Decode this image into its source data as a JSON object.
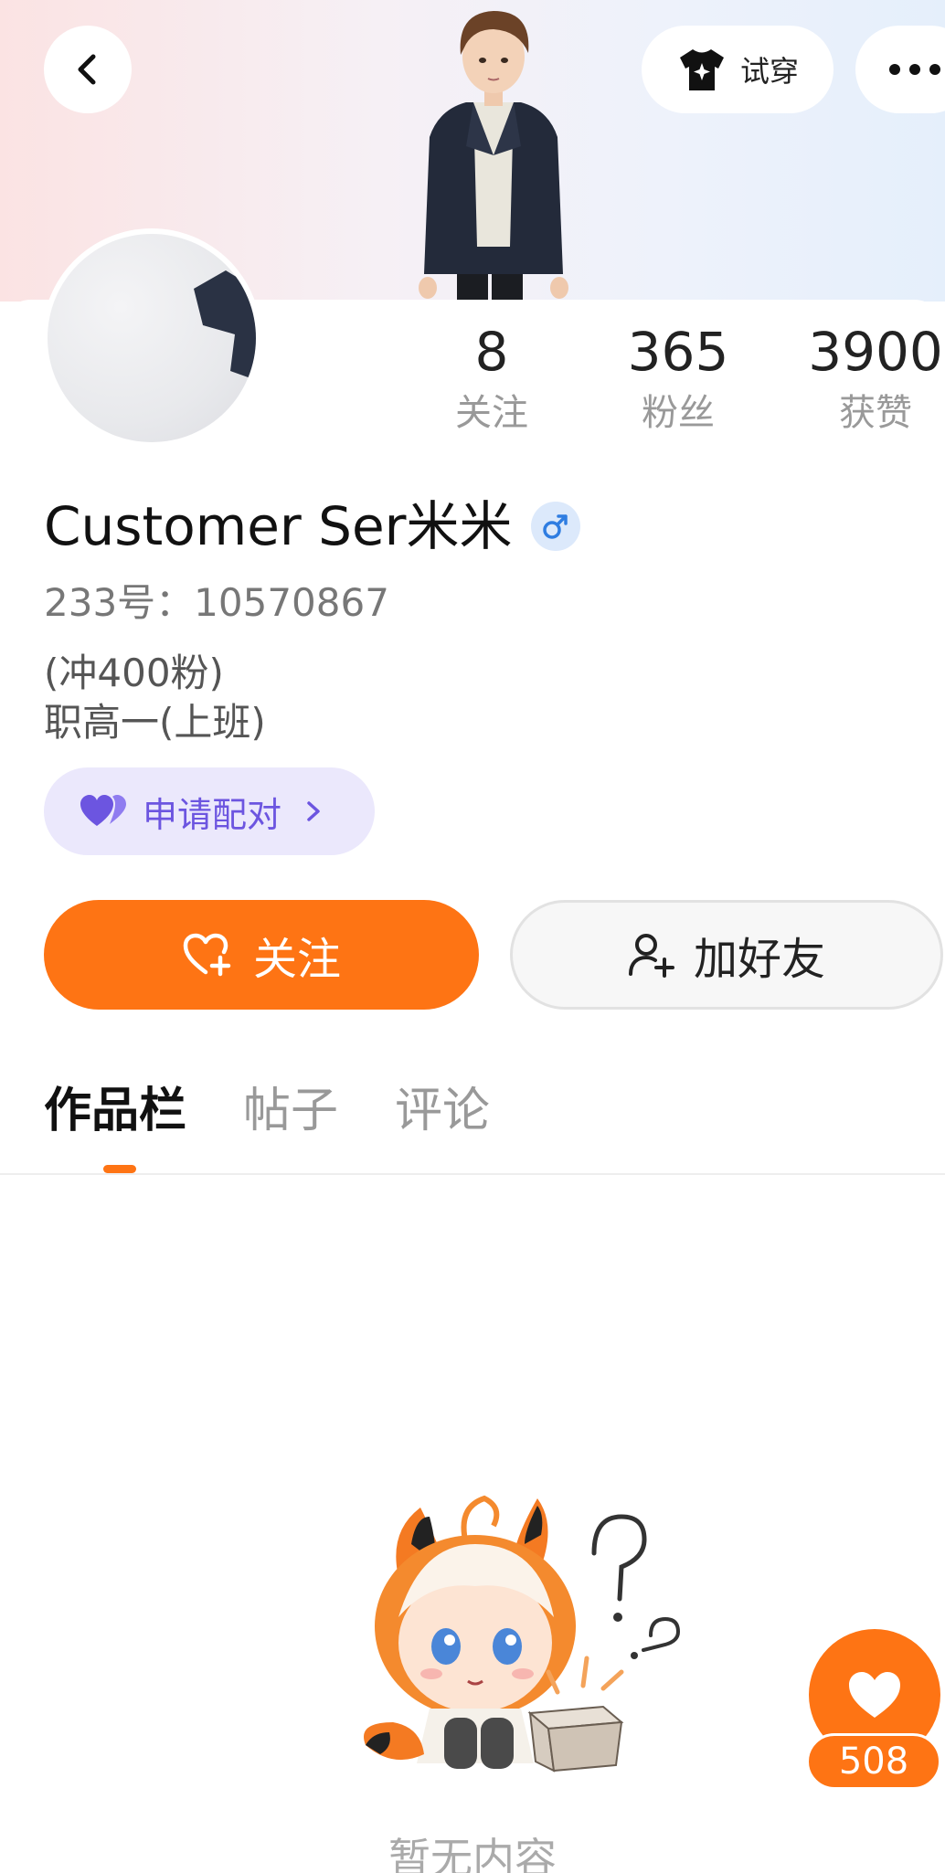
{
  "header": {
    "tryon_label": "试穿"
  },
  "stats": [
    {
      "value": "8",
      "label": "关注"
    },
    {
      "value": "365",
      "label": "粉丝"
    },
    {
      "value": "3900",
      "label": "获赞"
    }
  ],
  "profile": {
    "name": "Customer Ser米米",
    "gender_icon": "male-icon",
    "uid": "233号：10570867",
    "bio_line1": "(冲400粉)",
    "bio_line2": "职高一(上班)"
  },
  "pair_button": {
    "label": "申请配对"
  },
  "actions": {
    "follow_label": "关注",
    "add_friend_label": "加好友"
  },
  "tabs": [
    {
      "label": "作品栏",
      "active": true
    },
    {
      "label": "帖子",
      "active": false
    },
    {
      "label": "评论",
      "active": false
    }
  ],
  "empty_state": {
    "text": "暂无内容"
  },
  "like_fab": {
    "count": "508"
  },
  "colors": {
    "accent": "#fe7414",
    "pair_bg": "#ebe8fc",
    "pair_text": "#6c55e0",
    "gender_badge": "#dce9fb"
  }
}
